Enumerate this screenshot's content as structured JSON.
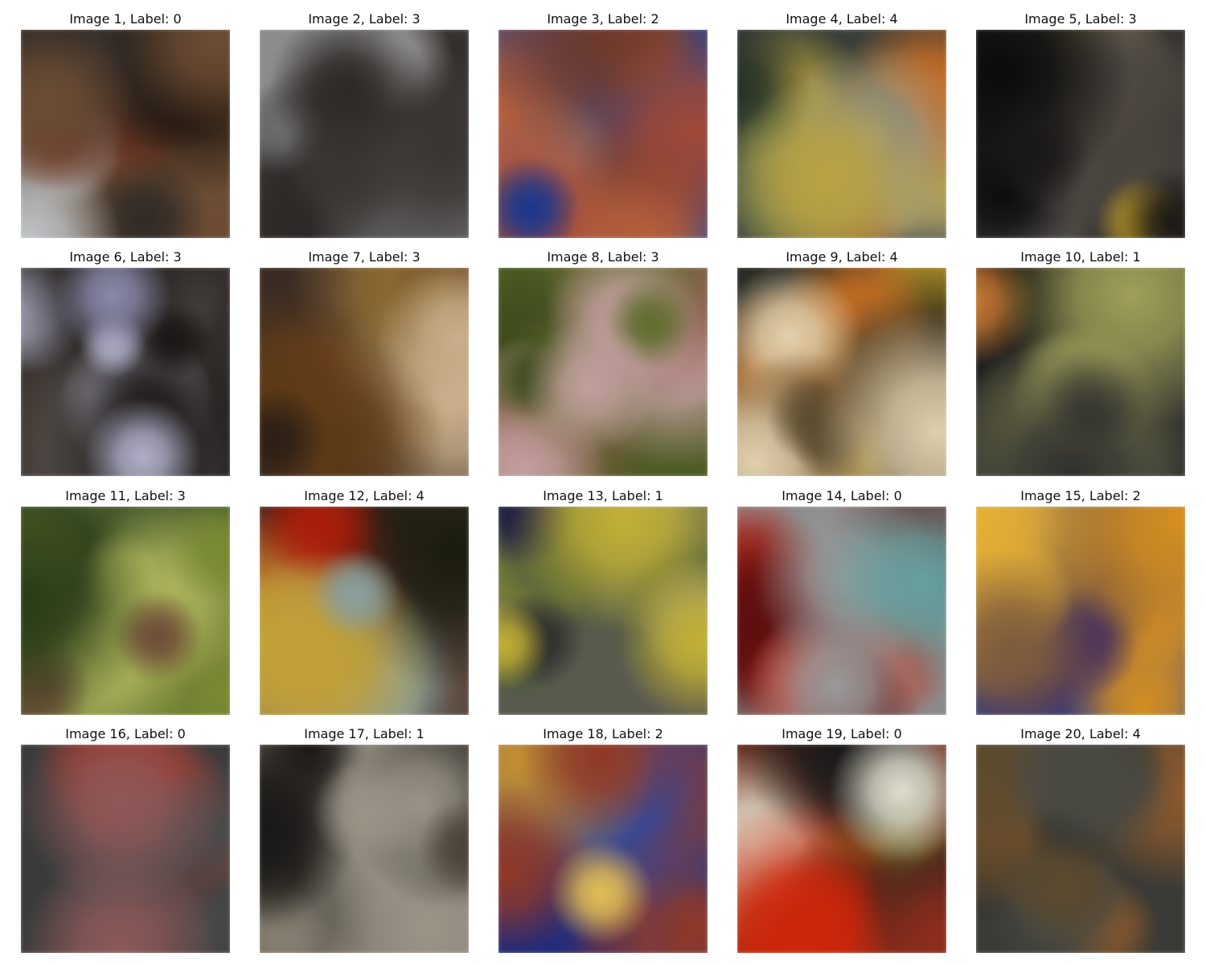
{
  "images": [
    {
      "caption": "Image 1, Label: 0",
      "background": "#5b4636",
      "colors": [
        "#1e150f",
        "#8a3a22",
        "#c0c5c8",
        "#2e2a26",
        "#6b4d36"
      ]
    },
    {
      "caption": "Image 2, Label: 3",
      "background": "#8c8c8c",
      "colors": [
        "#2d2926",
        "#4a4541",
        "#b4b4b4",
        "#6e6e6e",
        "#3a3532"
      ]
    },
    {
      "caption": "Image 3, Label: 2",
      "background": "#244a9a",
      "colors": [
        "#6a3a2c",
        "#9a4a3a",
        "#6fa0c8",
        "#1a3688",
        "#b06040"
      ]
    },
    {
      "caption": "Image 4, Label: 4",
      "background": "#3a3f3a",
      "colors": [
        "#c06a2a",
        "#7c8c5a",
        "#b8a24a",
        "#243028",
        "#9a9a8a"
      ]
    },
    {
      "caption": "Image 5, Label: 3",
      "background": "#2a2826",
      "colors": [
        "#0a0a0a",
        "#4a4540",
        "#c0a030",
        "#1a1816",
        "#6a6660"
      ]
    },
    {
      "caption": "Image 6, Label: 3",
      "background": "#3a3430",
      "colors": [
        "#8a8aa8",
        "#1a1614",
        "#5a5550",
        "#b0b0c8",
        "#2a2624"
      ]
    },
    {
      "caption": "Image 7, Label: 3",
      "background": "#3a2c24",
      "colors": [
        "#7a4a2a",
        "#c8b090",
        "#5a3a1a",
        "#8a6a3a",
        "#2a1e16"
      ]
    },
    {
      "caption": "Image 8, Label: 3",
      "background": "#4e5a28",
      "colors": [
        "#5e6a30",
        "#7a4a38",
        "#c0a0a0",
        "#3e4a20",
        "#8a6050"
      ]
    },
    {
      "caption": "Image 9, Label: 4",
      "background": "#2a2a24",
      "colors": [
        "#c0702a",
        "#a08a30",
        "#5a4a30",
        "#e0d0b0",
        "#1a1a16"
      ]
    },
    {
      "caption": "Image 10, Label: 1",
      "background": "#1a1a1a",
      "colors": [
        "#4a4a4a",
        "#0a0a0a",
        "#a0a060",
        "#c07a3a",
        "#2e2e2e"
      ]
    },
    {
      "caption": "Image 11, Label: 3",
      "background": "#4a5a30",
      "colors": [
        "#7a8a3a",
        "#5a3a2a",
        "#2a3a1a",
        "#aab060",
        "#6a4a3a"
      ]
    },
    {
      "caption": "Image 12, Label: 4",
      "background": "#5a4a40",
      "colors": [
        "#a02010",
        "#8aa0a0",
        "#c0a040",
        "#1a1a10",
        "#6a7a6a"
      ]
    },
    {
      "caption": "Image 13, Label: 1",
      "background": "#5a5a50",
      "colors": [
        "#2a2a2a",
        "#8a8a80",
        "#c0b040",
        "#1a1a40",
        "#4a5a3a"
      ]
    },
    {
      "caption": "Image 14, Label: 0",
      "background": "#8a8a8a",
      "colors": [
        "#a0201a",
        "#6aa0a0",
        "#5a1010",
        "#9a9a9a",
        "#c03020"
      ]
    },
    {
      "caption": "Image 15, Label: 2",
      "background": "#1a3a9a",
      "colors": [
        "#d0902a",
        "#7a5a40",
        "#2a4ab0",
        "#e0b040",
        "#3a2a60"
      ]
    },
    {
      "caption": "Image 16, Label: 0",
      "background": "#3a3a3a",
      "colors": [
        "#1a1a1a",
        "#8a5a5a",
        "#c0c0c0",
        "#a02a20",
        "#4a4a4a"
      ]
    },
    {
      "caption": "Image 17, Label: 1",
      "background": "#6a6258",
      "colors": [
        "#1a1816",
        "#9a9488",
        "#4a4238",
        "#b0a898",
        "#2a2824"
      ]
    },
    {
      "caption": "Image 18, Label: 2",
      "background": "#1a3a8a",
      "colors": [
        "#c0903a",
        "#8a3a2a",
        "#1a2a7a",
        "#e0c060",
        "#2a4aa0"
      ]
    },
    {
      "caption": "Image 19, Label: 0",
      "background": "#5a2a1a",
      "colors": [
        "#c02a10",
        "#d0c040",
        "#1a1a1a",
        "#e0e0d0",
        "#8a3020"
      ]
    },
    {
      "caption": "Image 20, Label: 4",
      "background": "#3a3a36",
      "colors": [
        "#4a4a44",
        "#8a5a30",
        "#c04a30",
        "#2a2a28",
        "#5a4a30"
      ]
    }
  ]
}
